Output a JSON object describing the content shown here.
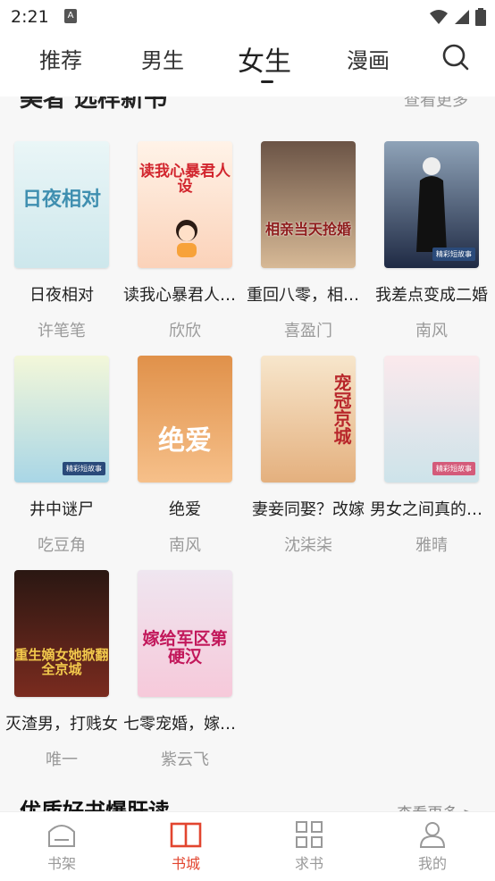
{
  "status_bar": {
    "time": "2:21",
    "notification_glyph": "A"
  },
  "top_tabs": [
    {
      "label": "推荐"
    },
    {
      "label": "男生"
    },
    {
      "label": "女生",
      "active": true
    },
    {
      "label": "漫画"
    }
  ],
  "section_peek": {
    "title": "美者 选样新书",
    "more": "查看更多"
  },
  "books": [
    {
      "title": "日夜相对",
      "author": "许笔笔",
      "cover_text": "日夜相对",
      "cover_bg": "#dbeff2",
      "cover_fg": "#3f8fb0"
    },
    {
      "title": "读我心暴君人设崩了",
      "author": "欣欣",
      "cover_text": "读我心暴君人设",
      "cover_bg": "#fde6d6",
      "cover_fg": "#d2262e"
    },
    {
      "title": "重回八零，相亲当天闪婚",
      "author": "喜盈门",
      "cover_text": "相亲当天抢婚",
      "cover_bg": "#c9a98a",
      "cover_fg": "#8e1b1b"
    },
    {
      "title": "我差点变成二婚",
      "author": "南风",
      "cover_text": "",
      "cover_bg": "#2f3a55",
      "cover_fg": "#ffffff",
      "badge": "精彩短故事"
    },
    {
      "title": "井中谜尸",
      "author": "吃豆角",
      "cover_text": "",
      "cover_bg": "#cfe6ef",
      "cover_fg": "#ffffff",
      "badge": "精彩短故事"
    },
    {
      "title": "绝爱",
      "author": "南风",
      "cover_text": "绝爱",
      "cover_bg": "#f0a561",
      "cover_fg": "#ffffff"
    },
    {
      "title": "妻妾同娶？改嫁",
      "author": "沈柒柒",
      "cover_text": "宠冠京城",
      "cover_bg": "#f4dcc0",
      "cover_fg": "#b8262a"
    },
    {
      "title": "男女之间真的有纯友谊",
      "author": "雅晴",
      "cover_text": "",
      "cover_bg": "#f1d3d8",
      "cover_fg": "#ffffff",
      "badge": "精彩短故事"
    },
    {
      "title": "灭渣男，打贱女",
      "author": "唯一",
      "cover_text": "重生嫡女她掀翻全京城",
      "cover_bg": "#3a2019",
      "cover_fg": "#f2c94c"
    },
    {
      "title": "七零宠婚，嫁给军区",
      "author": "紫云飞",
      "cover_text": "嫁给军区第硬汉",
      "cover_bg": "#f3dbe6",
      "cover_fg": "#c2185b"
    }
  ],
  "section2": {
    "title": "优质好书爆肝读",
    "more": "查看更多 >"
  },
  "bottom_nav": [
    {
      "label": "书架",
      "icon": "shelf-icon"
    },
    {
      "label": "书城",
      "icon": "book-icon",
      "active": true
    },
    {
      "label": "求书",
      "icon": "grid-icon"
    },
    {
      "label": "我的",
      "icon": "user-icon"
    }
  ],
  "colors": {
    "accent": "#e2452f",
    "muted": "#9a9a9a"
  }
}
